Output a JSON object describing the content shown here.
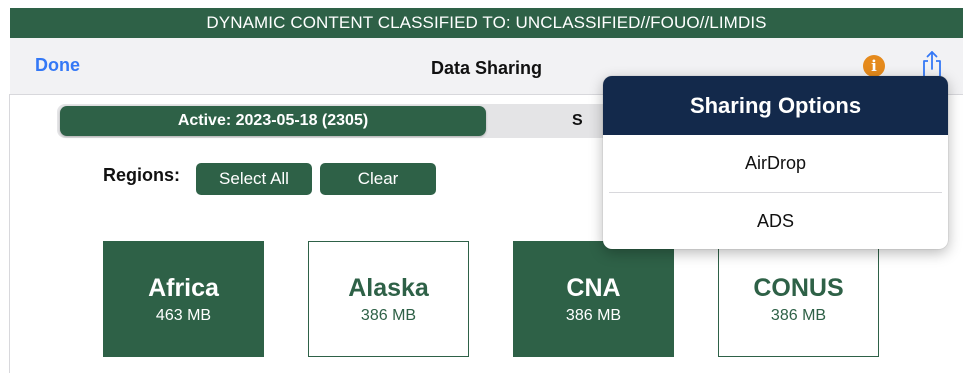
{
  "banner": {
    "text": "DYNAMIC CONTENT CLASSIFIED TO: UNCLASSIFIED//FOUO//LIMDIS"
  },
  "navbar": {
    "done_label": "Done",
    "title": "Data Sharing",
    "info_icon": "info-icon",
    "share_icon": "share-icon"
  },
  "segment": {
    "active_label": "Active: 2023-05-18 (2305)",
    "other_label": "S"
  },
  "regions": {
    "label": "Regions:",
    "select_all_label": "Select All",
    "clear_label": "Clear",
    "tiles": [
      {
        "name": "Africa",
        "size": "463 MB",
        "selected": true
      },
      {
        "name": "Alaska",
        "size": "386 MB",
        "selected": false
      },
      {
        "name": "CNA",
        "size": "386 MB",
        "selected": true
      },
      {
        "name": "CONUS",
        "size": "386 MB",
        "selected": false
      }
    ]
  },
  "popover": {
    "title": "Sharing Options",
    "items": [
      {
        "label": "AirDrop"
      },
      {
        "label": "ADS"
      }
    ]
  },
  "colors": {
    "accent_green": "#2e6147",
    "popover_header_navy": "#13294b",
    "link_blue": "#3478f6",
    "info_orange": "#e58a1c"
  }
}
